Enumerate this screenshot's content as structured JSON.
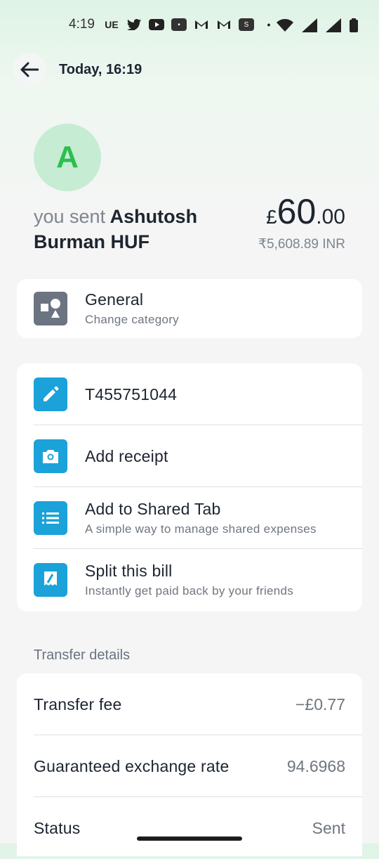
{
  "status_bar": {
    "time": "4:19",
    "carrier": "UE",
    "icons": [
      "twitter-icon",
      "youtube-icon",
      "app-icon",
      "gmail-icon",
      "gmail-icon",
      "s-icon",
      "dot-icon",
      "wifi-icon",
      "signal-icon",
      "signal-icon",
      "battery-icon"
    ],
    "s_label": "S"
  },
  "header": {
    "title": "Today, 16:19"
  },
  "recipient": {
    "initial": "A",
    "prefix": "you sent",
    "name": "Ashutosh Burman HUF"
  },
  "amount": {
    "currency": "£",
    "whole": "60",
    "decimal": ".00",
    "converted": "₹5,608.89 INR"
  },
  "category": {
    "title": "General",
    "subtitle": "Change category"
  },
  "actions": [
    {
      "title": "T455751044",
      "subtitle": "",
      "icon": "pencil-icon"
    },
    {
      "title": "Add receipt",
      "subtitle": "",
      "icon": "camera-icon"
    },
    {
      "title": "Add to Shared Tab",
      "subtitle": "A simple way to manage shared expenses",
      "icon": "list-icon"
    },
    {
      "title": "Split this bill",
      "subtitle": "Instantly get paid back by your friends",
      "icon": "receipt-icon"
    }
  ],
  "transfer_details": {
    "label": "Transfer details",
    "rows": [
      {
        "label": "Transfer fee",
        "value": "−£0.77"
      },
      {
        "label": "Guaranteed exchange rate",
        "value": "94.6968"
      },
      {
        "label": "Status",
        "value": "Sent"
      }
    ]
  },
  "colors": {
    "accent_blue": "#1aa2d9",
    "avatar_green": "#2bbf4d",
    "avatar_bg": "#c6ecd4"
  }
}
